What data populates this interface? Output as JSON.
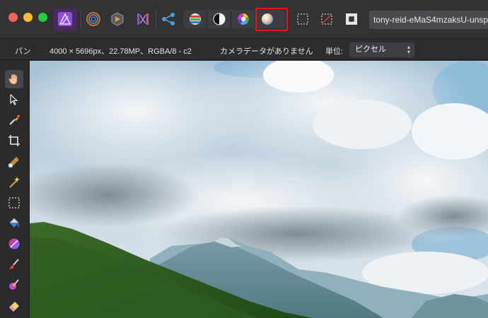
{
  "window": {
    "filename": "tony-reid-eMaS4mzaksU-unsp"
  },
  "context_bar": {
    "tool_name": "パン",
    "image_info": "4000 × 5696px、22.78MP、RGBA/8 - c2",
    "camera_data": "カメラデータがありません",
    "unit_label": "単位:",
    "unit_value": "ピクセル"
  },
  "toolbar_personas": [
    "photo-persona-icon",
    "liquify-persona-icon",
    "develop-persona-icon",
    "tone-mapping-persona-icon",
    "export-persona-icon"
  ],
  "studio_buttons": [
    "histogram-icon",
    "tone-icon",
    "color-wheel-icon",
    "gradient-sphere-icon"
  ],
  "selection_buttons": [
    "marquee-select-icon",
    "clear-selection-icon",
    "invert-selection-icon"
  ],
  "tools": [
    "hand-icon",
    "move-icon",
    "color-picker-icon",
    "crop-icon",
    "selection-brush-icon",
    "magic-wand-icon",
    "marquee-icon",
    "flood-fill-icon",
    "gradient-icon",
    "paint-brush-icon",
    "clone-brush-icon",
    "eraser-icon"
  ],
  "colors": {
    "accent_photo": "#b45cff",
    "highlight_box": "#e01818",
    "sky": "#8fb9d6",
    "forest": "#2c5a1e"
  }
}
